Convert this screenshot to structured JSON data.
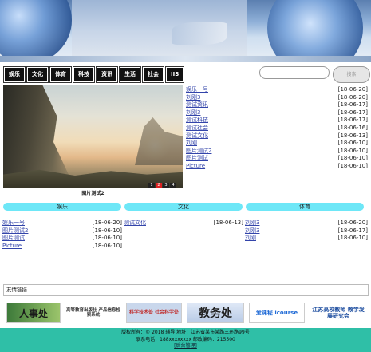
{
  "search": {
    "placeholder": "",
    "button_label": "搜索"
  },
  "nav": [
    "娱乐",
    "文化",
    "体育",
    "科技",
    "资讯",
    "生活",
    "社会",
    "IIS"
  ],
  "slideshow": {
    "caption": "图片测试2",
    "pages": [
      "1",
      "2",
      "3",
      "4"
    ],
    "active_page": 2
  },
  "news": [
    {
      "title": "娱乐一号",
      "date": "[18-06-20]"
    },
    {
      "title": "刘刚3",
      "date": "[18-06-20]"
    },
    {
      "title": "测试资讯",
      "date": "[18-06-17]"
    },
    {
      "title": "刘刚3",
      "date": "[18-06-17]"
    },
    {
      "title": "测试科技",
      "date": "[18-06-17]"
    },
    {
      "title": "测试社会",
      "date": "[18-06-16]"
    },
    {
      "title": "测试文化",
      "date": "[18-06-13]"
    },
    {
      "title": "刘刚",
      "date": "[18-06-10]"
    },
    {
      "title": "图片测试2",
      "date": "[18-06-10]"
    },
    {
      "title": "图片测试",
      "date": "[18-06-10]"
    },
    {
      "title": "Picture",
      "date": "[18-06-10]"
    }
  ],
  "sections": [
    {
      "title": "娱乐",
      "items": [
        {
          "title": "娱乐一号",
          "date": "[18-06-20]"
        },
        {
          "title": "图片测试2",
          "date": "[18-06-10]"
        },
        {
          "title": "图片测试",
          "date": "[18-06-10]"
        },
        {
          "title": "Picture",
          "date": "[18-06-10]"
        }
      ]
    },
    {
      "title": "文化",
      "items": [
        {
          "title": "测试文化",
          "date": "[18-06-13]"
        }
      ]
    },
    {
      "title": "体育",
      "items": [
        {
          "title": "刘刚3",
          "date": "[18-06-20]"
        },
        {
          "title": "刘刚3",
          "date": "[18-06-17]"
        },
        {
          "title": "刘刚",
          "date": "[18-06-10]"
        }
      ]
    }
  ],
  "friend_links": {
    "title": "友情链接"
  },
  "logos": [
    {
      "name": "人事处"
    },
    {
      "name": "高等教育出版社 产品信息检索系统"
    },
    {
      "name": "科学技术处 社会科学处"
    },
    {
      "name": "教务处"
    },
    {
      "name": "爱课程 icourse"
    },
    {
      "name": "江苏高校教师 教学发展研究会"
    }
  ],
  "footer": {
    "line1": "版权所有：© 2018 辅导  地址：江苏省某市某路三环路99号",
    "line2": "联系电话：188xxxxxxxx  邮政编码：215500",
    "login": "[后台管理]"
  },
  "colors": {
    "nav_bg": "#111111",
    "section_bar": "#6ee7f7",
    "footer_bg": "#2fbfa7",
    "link": "#3344aa",
    "active_dot": "#dd2222"
  }
}
